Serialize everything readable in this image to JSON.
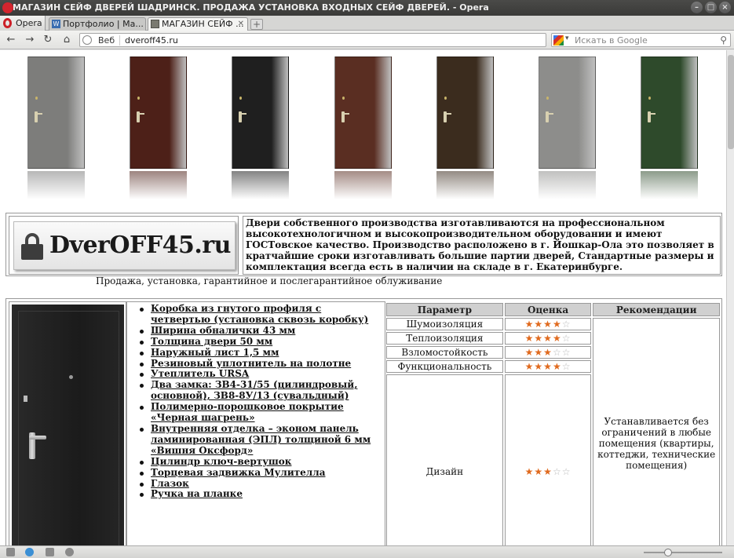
{
  "window": {
    "title": "МАГАЗИН СЕЙФ ДВЕРЕЙ ШАДРИНСК. ПРОДАЖА УСТАНОВКА ВХОДНЫХ СЕЙФ ДВЕРЕЙ. - Opera",
    "controls": [
      "–",
      "□",
      "×"
    ]
  },
  "browser": {
    "menu_label": "Opera",
    "tabs": [
      {
        "label": "Портфолио | Ма...",
        "icon": "word-press-icon"
      },
      {
        "label": "МАГАЗИН СЕЙФ ...",
        "icon": "door-icon",
        "active": true
      }
    ],
    "nav": {
      "back": "←",
      "forward": "→",
      "reload": "↻",
      "home": "⌂"
    },
    "address": {
      "scope": "Веб",
      "url": "dveroff45.ru"
    },
    "search": {
      "placeholder": "Искать в Google",
      "engine": "google-icon"
    }
  },
  "page": {
    "doors": [
      {
        "color": "#7d7d7b",
        "name": "grey"
      },
      {
        "color": "#4d2018",
        "name": "dark-red"
      },
      {
        "color": "#1f1f1f",
        "name": "black"
      },
      {
        "color": "#5a2e22",
        "name": "brown-red"
      },
      {
        "color": "#3b2c1e",
        "name": "dark-brown"
      },
      {
        "color": "#8d8d8b",
        "name": "silver"
      },
      {
        "color": "#2e4a2b",
        "name": "green"
      }
    ],
    "logo_text": "DverOFF45.ru",
    "intro": "Двери собственного производства изготавливаются на профессиональном высокотехнологичном и высокопроизводительном оборудовании и имеют ГОСТовское качество. Производство расположено в г. Йошкар-Ола это позволяет в кратчайшие сроки изготавливать большие партии дверей, Стандартные размеры и комплектация всегда есть в наличии на складе в г. Екатеринбурге.",
    "service_line": "Продажа, установка, гарантийное и послегарантийное облуживание",
    "features": [
      "Коробка из гнутого профиля с четвертью (установка сквозь коробку)",
      "Ширина обналички 43 мм",
      "Толщина двери 50 мм",
      "Наружный лист 1,5 мм",
      "Резиновый уплотнитель на полотне",
      "Утеплитель URSA",
      "Два замка: ЗВ4-31/55 (цилиндровый, основной), ЗВ8-8У/13 (сувальдный)",
      "Полимерно-порошковое покрытие «Черная шагрень»",
      "Внутренняя отделка – эконом панель ламинированная (ЭПЛ) толщиной 6 мм «Вишня Оксфорд»",
      "Цилиндр ключ-вертушок",
      "Торцевая задвижка Мулителла",
      "Глазок",
      "Ручка на планке"
    ],
    "params_table": {
      "headers": [
        "Параметр",
        "Оценка",
        "Рекомендации"
      ],
      "rows": [
        {
          "param": "Шумоизоляция",
          "rating": 4
        },
        {
          "param": "Теплоизоляция",
          "rating": 4
        },
        {
          "param": "Взломостойкость",
          "rating": 3
        },
        {
          "param": "Функциональность",
          "rating": 4
        },
        {
          "param": "Дизайн",
          "rating": 3
        }
      ],
      "max_rating": 5,
      "recommendation": "Устанавливается без ограничений в любые помещения (квартиры, коттеджи, технические помещения)"
    }
  }
}
